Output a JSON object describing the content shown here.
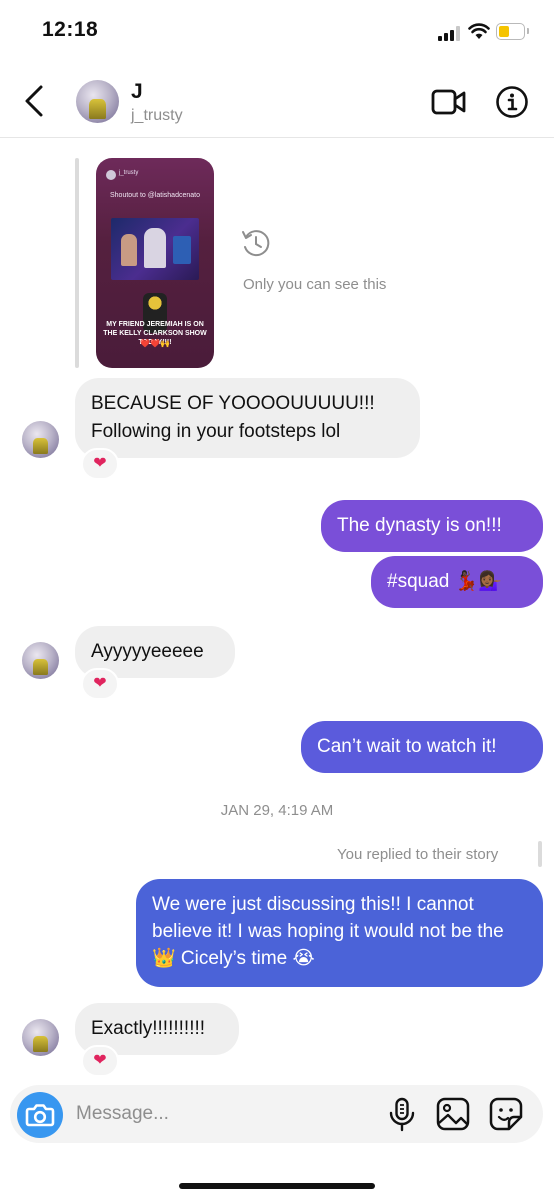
{
  "status_bar": {
    "time": "12:18"
  },
  "header": {
    "name": "J",
    "username": "j_trusty"
  },
  "story": {
    "handle": "j_trusty",
    "shoutout": "Shoutout to @latishadcenato",
    "caption": "MY FRIEND JEREMIAH IS ON THE KELLY CLARKSON SHOW TODAY!!!!",
    "hearts": "❤️❤️🙌",
    "note": "Only you can see this"
  },
  "messages": [
    {
      "text": "BECAUSE OF YOOOOUUUUU!!!\nFollowing in your footsteps lol",
      "reaction": "❤"
    },
    {
      "text": "The dynasty is on!!!"
    },
    {
      "text": "#squad 💃🏿💁🏾‍♀️"
    },
    {
      "text": "Ayyyyyeeeee",
      "reaction": "❤"
    },
    {
      "text": "Can’t wait to watch it!"
    },
    {
      "text": "We were just discussing this!! I cannot believe it! I was hoping it would not be the 👑 Cicely’s time 😭"
    },
    {
      "text": "Exactly!!!!!!!!!!",
      "reaction": "❤"
    }
  ],
  "timestamp": "JAN 29, 4:19 AM",
  "replied_label": "You replied to their story",
  "composer": {
    "placeholder": "Message..."
  },
  "colors": {
    "accent_blue": "#3897f0",
    "bubble_purple": "#7a4fd8",
    "bubble_blue": "#4b63d8",
    "bubble_gray": "#efefef"
  }
}
